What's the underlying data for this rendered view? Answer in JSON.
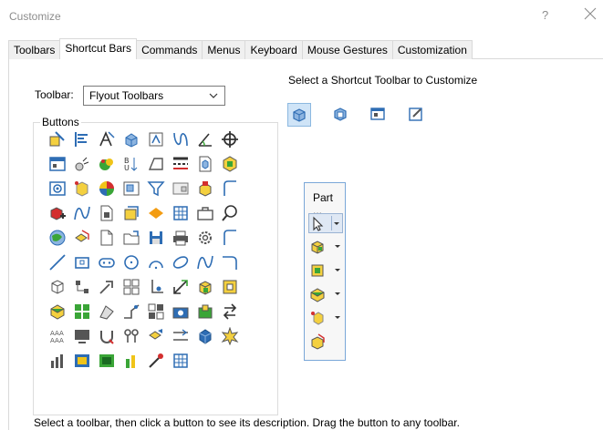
{
  "window": {
    "title": "Customize",
    "help_label": "?"
  },
  "tabs": [
    {
      "label": "Toolbars"
    },
    {
      "label": "Shortcut Bars"
    },
    {
      "label": "Commands"
    },
    {
      "label": "Menus"
    },
    {
      "label": "Keyboard"
    },
    {
      "label": "Mouse Gestures"
    },
    {
      "label": "Customization"
    }
  ],
  "active_tab": "Shortcut Bars",
  "toolbar": {
    "label": "Toolbar:",
    "selected": "Flyout Toolbars"
  },
  "buttons_group": {
    "legend": "Buttons"
  },
  "shortcut": {
    "heading": "Select a Shortcut Toolbar to Customize",
    "toolbars": [
      {
        "icon": "part-icon",
        "active": true
      },
      {
        "icon": "assembly-icon",
        "active": false
      },
      {
        "icon": "drawing-icon",
        "active": false
      },
      {
        "icon": "sketch-icon",
        "active": false
      }
    ]
  },
  "flyout": {
    "title": "Part ...",
    "items": [
      {
        "icon": "select-arrow-icon",
        "has_dropdown": true
      },
      {
        "icon": "features-icon",
        "has_dropdown": true
      },
      {
        "icon": "sheetmetal-icon",
        "has_dropdown": true
      },
      {
        "icon": "surfaces-icon",
        "has_dropdown": true
      },
      {
        "icon": "reference-geometry-icon",
        "has_dropdown": true
      },
      {
        "icon": "assembly-box-icon",
        "has_dropdown": false
      }
    ]
  },
  "description": "Select a toolbar, then click a button to see its description. Drag the button to any toolbar.",
  "colors": {
    "accent_blue": "#2e6db4",
    "yellow": "#f0c419",
    "green": "#3aa537",
    "red": "#d32f2f"
  }
}
